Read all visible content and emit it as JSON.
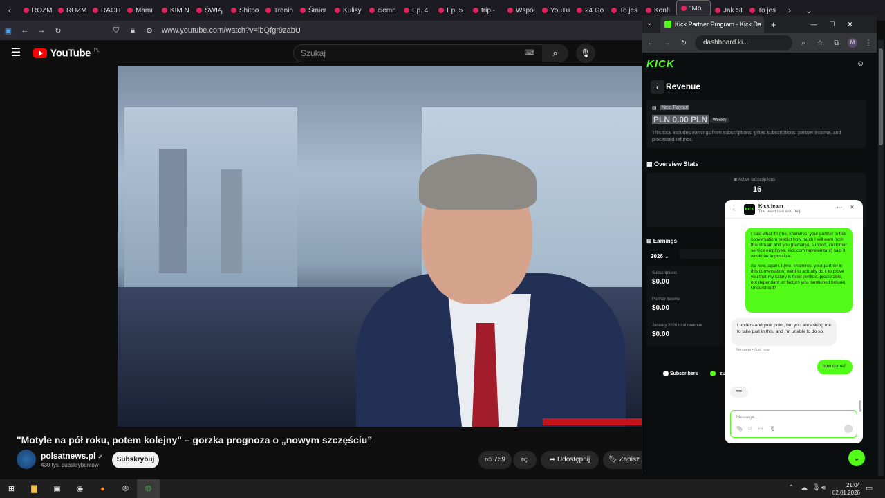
{
  "firefox": {
    "tabs": [
      "ROZM",
      "ROZM",
      "RACH",
      "Mamı",
      "KIM N",
      "ŚWIĄ",
      "Shitpo",
      "Trenin",
      "Śmier",
      "Kulisy",
      "ciemn",
      "Ep. 4",
      "Ep. 5",
      "trip -",
      "Współ",
      "YouTu",
      "24 Go",
      "To jes",
      "Konfi",
      "\"Mo",
      "Jak SI",
      "To jes"
    ],
    "url": "www.youtube.com/watch?v=ibQfgr9zabU"
  },
  "youtube": {
    "logo": "YouTube",
    "region": "PL",
    "search_placeholder": "Szukaj",
    "video_title": "\"Motyle na pół roku, potem kolejny\" – gorzka prognoza o „nowym szczęściu”",
    "channel": "polsatnews.pl",
    "subscribers": "430 tys. subskrybentów",
    "subscribe_label": "Subskrybuj",
    "likes": "759",
    "share_label": "Udostępnij",
    "save_label": "Zapisz"
  },
  "chrome": {
    "tab_title": "Kick Partner Program - Kick Da",
    "url": "dashboard.ki..."
  },
  "kick": {
    "logo": "KICK",
    "page_title": "Revenue",
    "next_payout_label": "Next Payout",
    "next_payout_value": "PLN 0.00 PLN",
    "payout_badge": "Weekly",
    "payout_note": "This total includes earnings from subscriptions, gifted subscriptions, partner income, and processed refunds.",
    "overview_title": "Overview Stats",
    "active_subs_label": "Active subscriptions",
    "active_subs_value": "16",
    "earnings_title": "Earnings",
    "year": "2026",
    "subscriptions_label": "Subscriptions",
    "subscriptions_value": "$0.00",
    "partner_income_label": "Partner income",
    "partner_income_value": "$0.00",
    "total_revenue_label": "January 2026 total revenue",
    "total_revenue_value": "$0.00",
    "legend_subscribers": "Subscribers",
    "legend_second": "su"
  },
  "chat": {
    "title": "Kick team",
    "subtitle": "The team can also help",
    "msg1_p1": "I said what if I (me, khamires, your partner in this conversation) predict how much I will earn from this stream and you (nemanja, support, customer service employee, kick.com representant) said it would be impossible.",
    "msg1_p2": "So now, again, I (me, khamires, your partner in this conversation) want to actually do it to prove you that my salary is fixed (limited, predictable, not dependant on factors you mentioned before). Understood?",
    "msg2": "I understand your point, but you are asking me to take part in this, and I'm unable to do so.",
    "msg2_meta": "Nemanja • Just now",
    "msg3": "how come?",
    "typing": "•••",
    "input_placeholder": "Message..."
  },
  "taskbar": {
    "time": "21:04",
    "date": "02.01.2026"
  }
}
